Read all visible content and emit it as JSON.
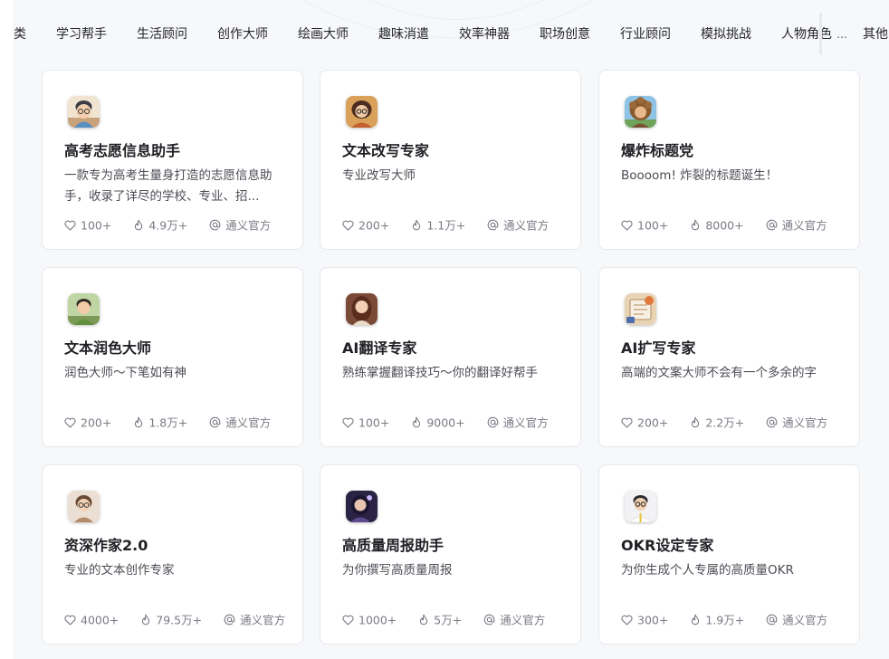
{
  "tabs": [
    "类",
    "学习帮手",
    "生活顾问",
    "创作大师",
    "绘画大师",
    "趣味消遣",
    "效率神器",
    "职场创意",
    "行业顾问",
    "模拟挑战",
    "人物角色",
    "其他"
  ],
  "tabs_more": "…",
  "cards": [
    {
      "title": "高考志愿信息助手",
      "desc": "一款专为高考生量身打造的志愿信息助手，收录了详尽的学校、专业、招...",
      "likes": "100+",
      "uses": "4.9万+",
      "author": "通义官方",
      "avatar": "boy-glasses"
    },
    {
      "title": "文本改写专家",
      "desc": "专业改写大师",
      "likes": "200+",
      "uses": "1.1万+",
      "author": "通义官方",
      "avatar": "girl-glasses-brown"
    },
    {
      "title": "爆炸标题党",
      "desc": "Boooom!  炸裂的标题诞生！",
      "likes": "100+",
      "uses": "8000+",
      "author": "通义官方",
      "avatar": "curly-hair"
    },
    {
      "title": "文本润色大师",
      "desc": "润色大师～下笔如有神",
      "likes": "200+",
      "uses": "1.8万+",
      "author": "通义官方",
      "avatar": "boy-green"
    },
    {
      "title": "AI翻译专家",
      "desc": "熟练掌握翻译技巧～你的翻译好帮手",
      "likes": "100+",
      "uses": "9000+",
      "author": "通义官方",
      "avatar": "girl-long-hair"
    },
    {
      "title": "AI扩写专家",
      "desc": "高端的文案大师不会有一个多余的字",
      "likes": "200+",
      "uses": "2.2万+",
      "author": "通义官方",
      "avatar": "notebook"
    },
    {
      "title": "资深作家2.0",
      "desc": "专业的文本创作专家",
      "likes": "4000+",
      "uses": "79.5万+",
      "author": "通义官方",
      "avatar": "writer-glasses"
    },
    {
      "title": "高质量周报助手",
      "desc": "为你撰写高质量周报",
      "likes": "1000+",
      "uses": "5万+",
      "author": "通义官方",
      "avatar": "girl-night"
    },
    {
      "title": "OKR设定专家",
      "desc": "为你生成个人专属的高质量OKR",
      "likes": "300+",
      "uses": "1.9万+",
      "author": "通义官方",
      "avatar": "man-glasses-suit"
    }
  ]
}
